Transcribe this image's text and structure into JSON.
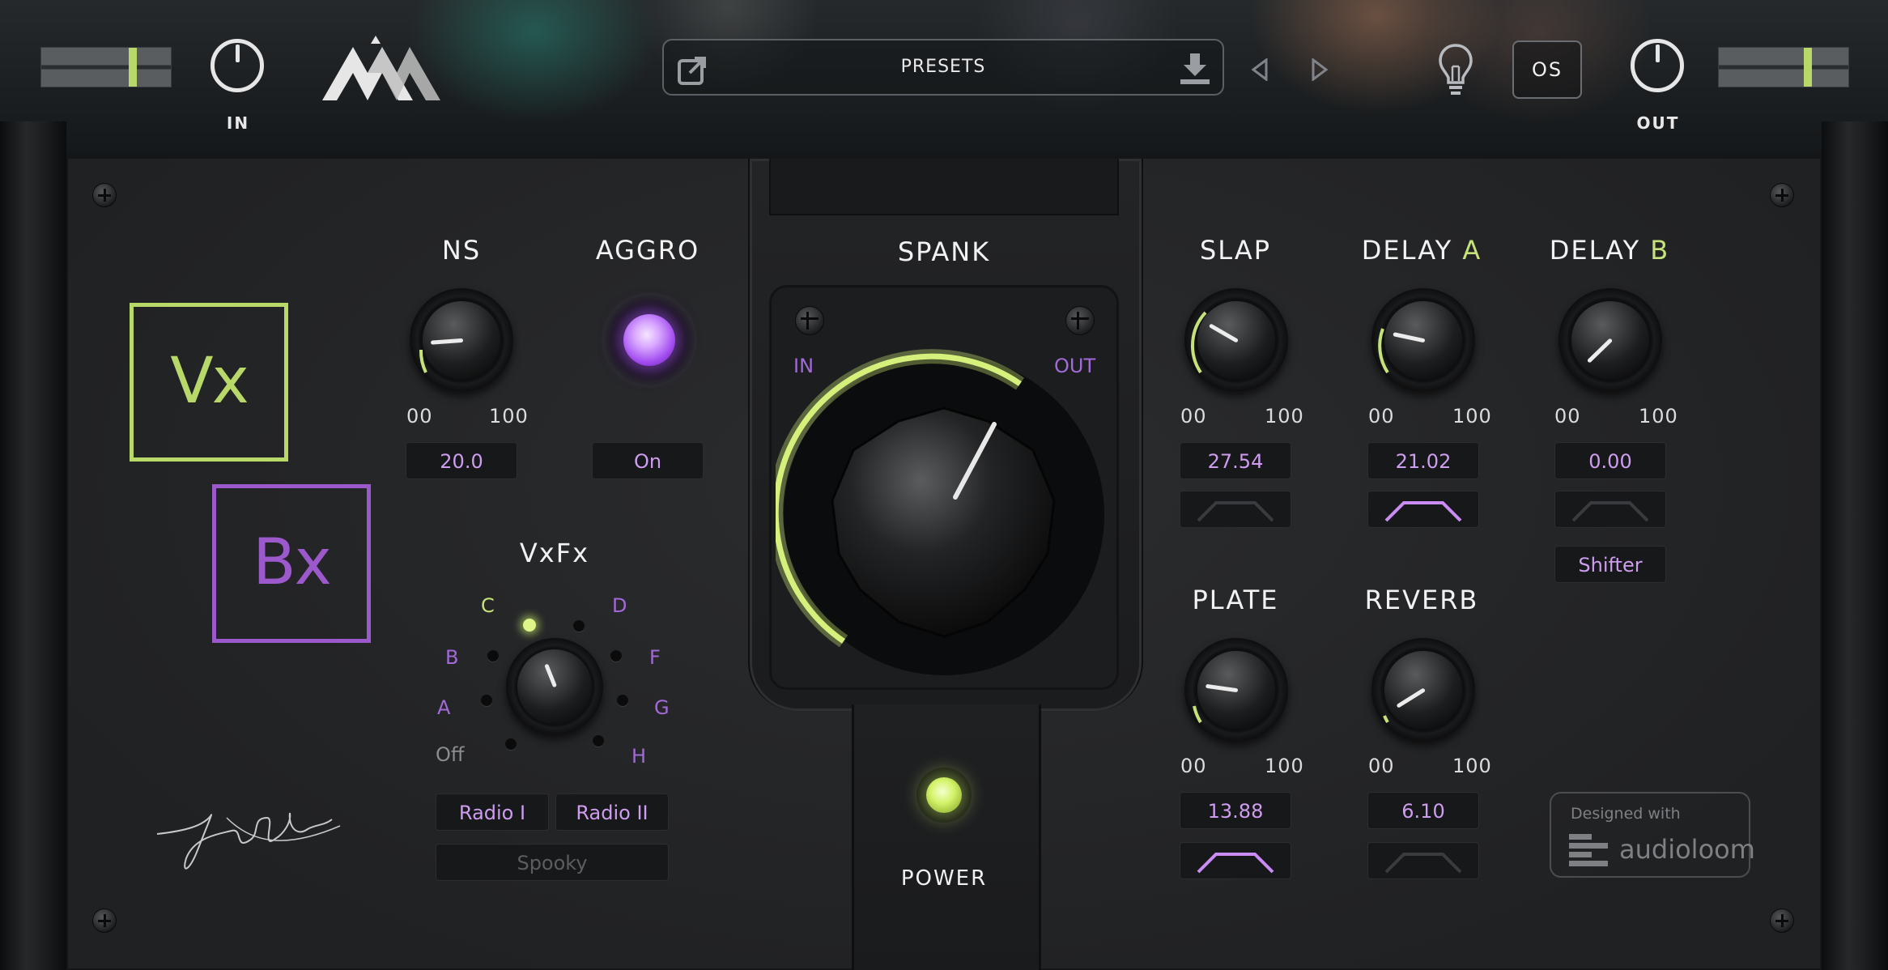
{
  "header": {
    "input_label": "IN",
    "output_label": "OUT",
    "presets_label": "PRESETS",
    "os_label": "OS",
    "input_meter_level": 0.72,
    "output_meter_level": 0.7
  },
  "left": {
    "vx_label": "Vx",
    "bx_label": "Bx"
  },
  "ns": {
    "label": "NS",
    "min": "00",
    "max": "100",
    "value": "20.0"
  },
  "aggro": {
    "label": "AGGRO",
    "value": "On"
  },
  "vxfx": {
    "label": "VxFx",
    "positions": [
      "Off",
      "A",
      "B",
      "C",
      "D",
      "F",
      "G",
      "H"
    ],
    "buttons": {
      "radio1": "Radio I",
      "radio2": "Radio II",
      "spooky": "Spooky"
    }
  },
  "spank": {
    "label": "SPANK",
    "in_label": "IN",
    "out_label": "OUT"
  },
  "power": {
    "label": "POWER"
  },
  "slap": {
    "label": "SLAP",
    "min": "00",
    "max": "100",
    "value": "27.54"
  },
  "delay_a": {
    "label": "DELAY",
    "suffix": "A",
    "min": "00",
    "max": "100",
    "value": "21.02"
  },
  "delay_b": {
    "label": "DELAY",
    "suffix": "B",
    "min": "00",
    "max": "100",
    "value": "0.00",
    "shifter": "Shifter"
  },
  "plate": {
    "label": "PLATE",
    "min": "00",
    "max": "100",
    "value": "13.88"
  },
  "reverb": {
    "label": "REVERB",
    "min": "00",
    "max": "100",
    "value": "6.10"
  },
  "badge": {
    "top": "Designed with",
    "brand": "audioloom"
  },
  "colors": {
    "accent_green": "#b9d86a",
    "accent_purple": "#9b59cc",
    "value_purple": "#ce9df0"
  }
}
